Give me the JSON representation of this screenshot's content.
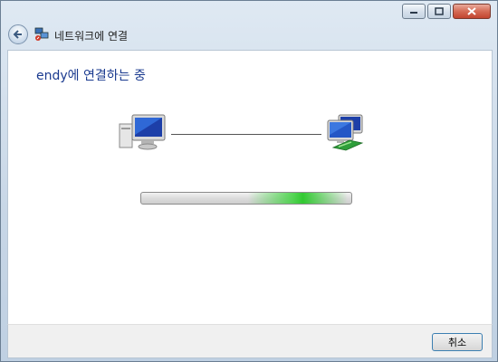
{
  "window": {
    "title": "네트워크에 연결",
    "caption_buttons": {
      "minimize_icon": "minimize-icon",
      "maximize_icon": "maximize-icon",
      "close_icon": "close-icon"
    },
    "back_icon": "back-arrow-icon"
  },
  "main": {
    "heading": "endy에 연결하는 중",
    "source_icon": "computer-icon",
    "target_icon": "network-icon",
    "progress_state": "indeterminate"
  },
  "footer": {
    "cancel_label": "취소"
  },
  "colors": {
    "heading": "#1a3a8f",
    "progress_glow": "#3cd23c",
    "chrome": "#c7d6e6"
  }
}
